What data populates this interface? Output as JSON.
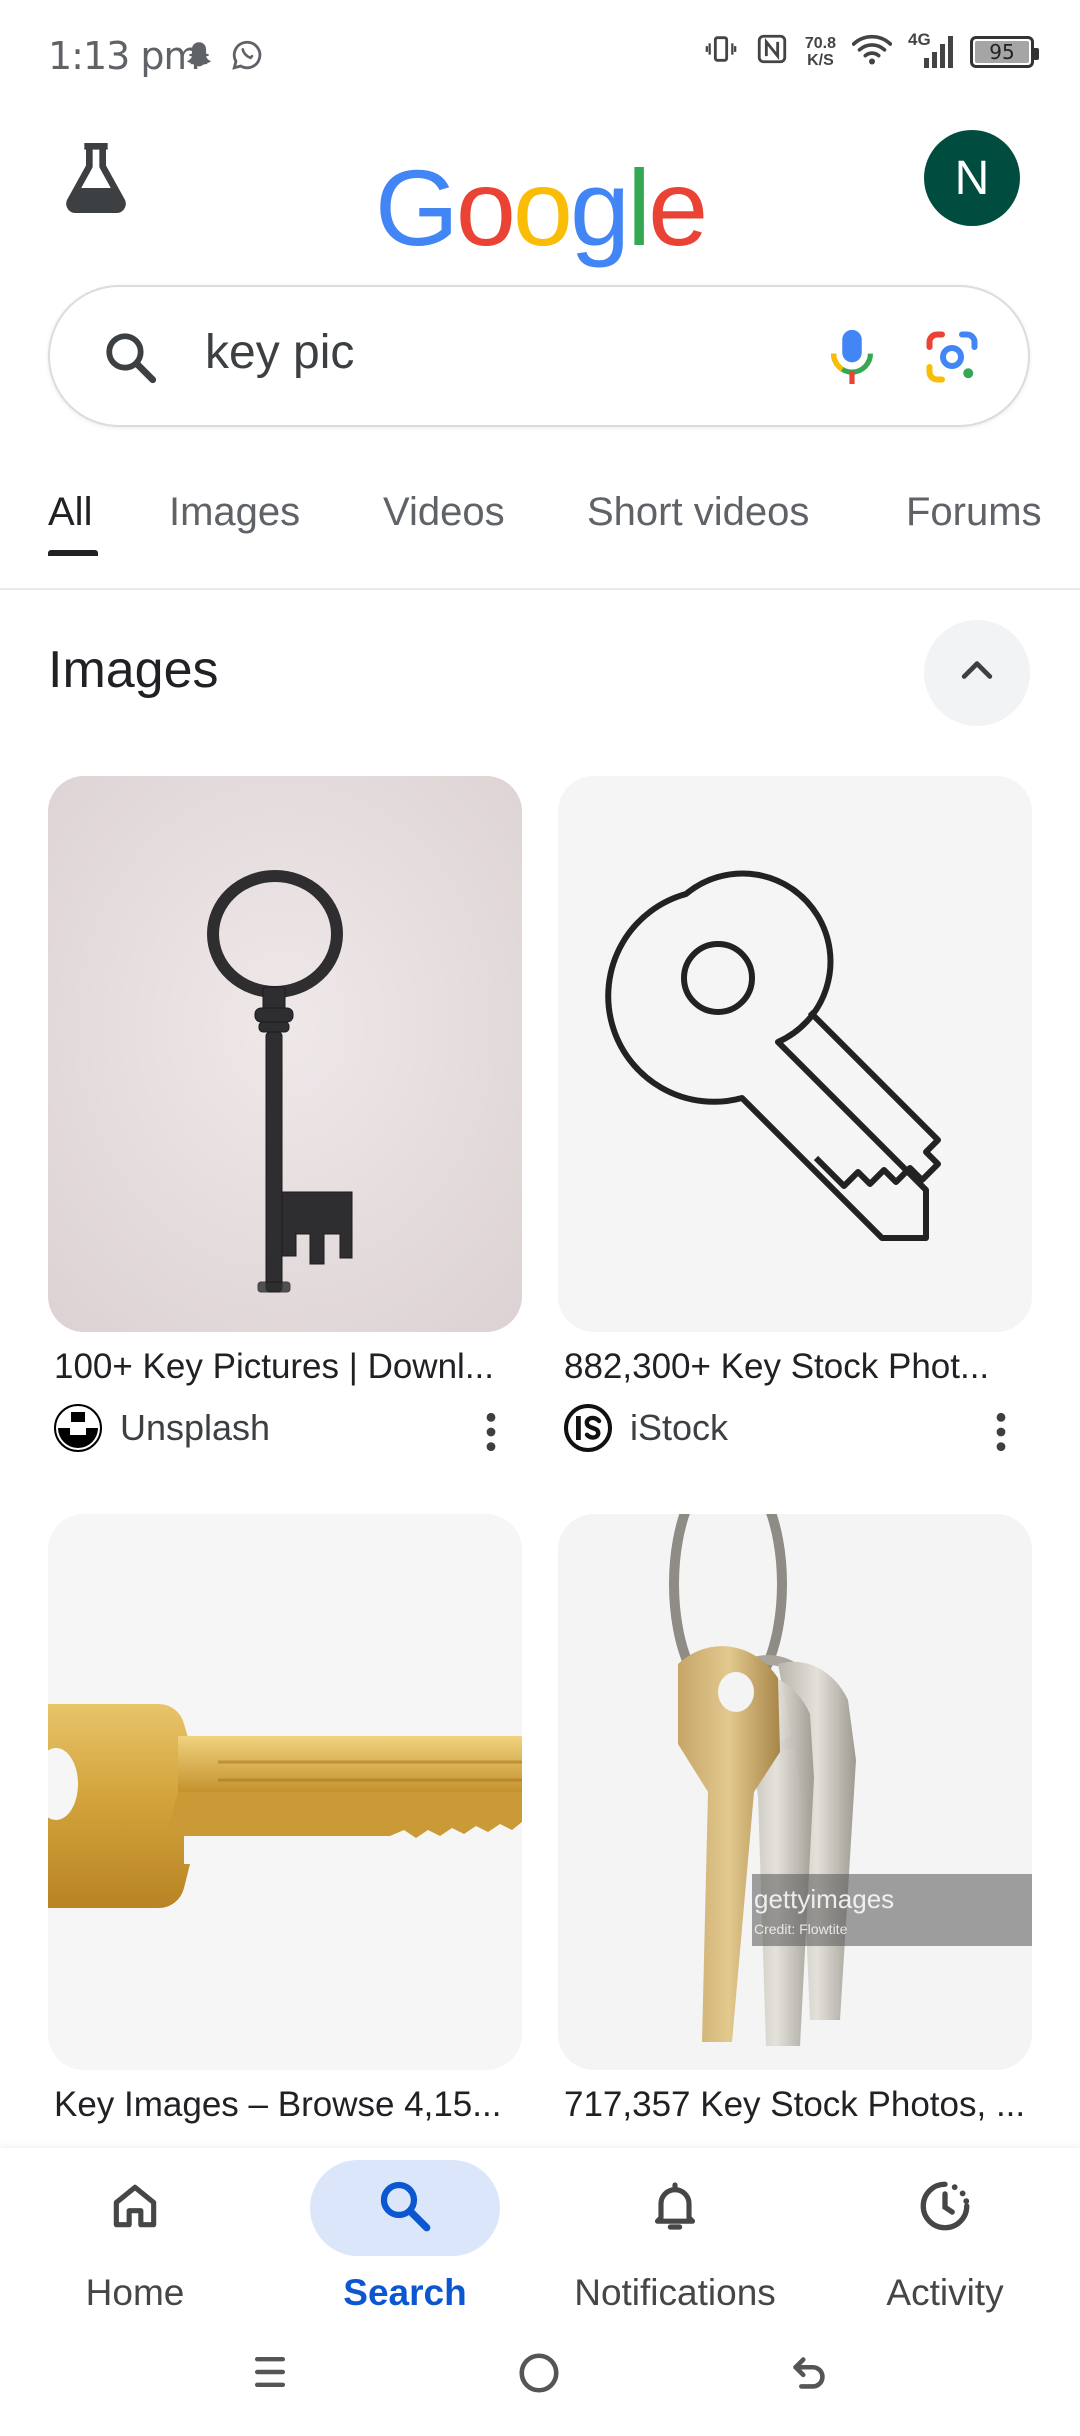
{
  "status_bar": {
    "time": "1:13 pm",
    "net_speed_value": "70.8",
    "net_speed_unit": "K/S",
    "network_type": "4G",
    "battery_level": "95"
  },
  "header": {
    "logo_letters": [
      {
        "char": "G",
        "color": "#4285F4"
      },
      {
        "char": "o",
        "color": "#EA4335"
      },
      {
        "char": "o",
        "color": "#FBBC05"
      },
      {
        "char": "g",
        "color": "#4285F4"
      },
      {
        "char": "l",
        "color": "#34A853"
      },
      {
        "char": "e",
        "color": "#EA4335"
      }
    ],
    "avatar_initial": "N",
    "avatar_color": "#004D40"
  },
  "search": {
    "query": "key pic"
  },
  "tabs": [
    {
      "label": "All",
      "active": true
    },
    {
      "label": "Images",
      "active": false
    },
    {
      "label": "Videos",
      "active": false
    },
    {
      "label": "Short videos",
      "active": false
    },
    {
      "label": "Forums",
      "active": false
    }
  ],
  "images_section": {
    "title": "Images",
    "results": [
      {
        "title": "100+ Key Pictures | Downl...",
        "source": "Unsplash"
      },
      {
        "title": "882,300+ Key Stock Phot...",
        "source": "iStock"
      },
      {
        "title": "Key Images – Browse 4,15...",
        "source": ""
      },
      {
        "title": "717,357 Key Stock Photos, ...",
        "source": "",
        "watermark": "gettyimages",
        "watermark_sub": "Credit: Flowtite"
      }
    ]
  },
  "bottom_nav": [
    {
      "label": "Home",
      "icon": "home-icon",
      "active": false
    },
    {
      "label": "Search",
      "icon": "search-icon",
      "active": true
    },
    {
      "label": "Notifications",
      "icon": "bell-icon",
      "active": false
    },
    {
      "label": "Activity",
      "icon": "activity-icon",
      "active": false
    }
  ],
  "colors": {
    "accent": "#0B57D0",
    "active_pill": "#DCE6FA"
  }
}
